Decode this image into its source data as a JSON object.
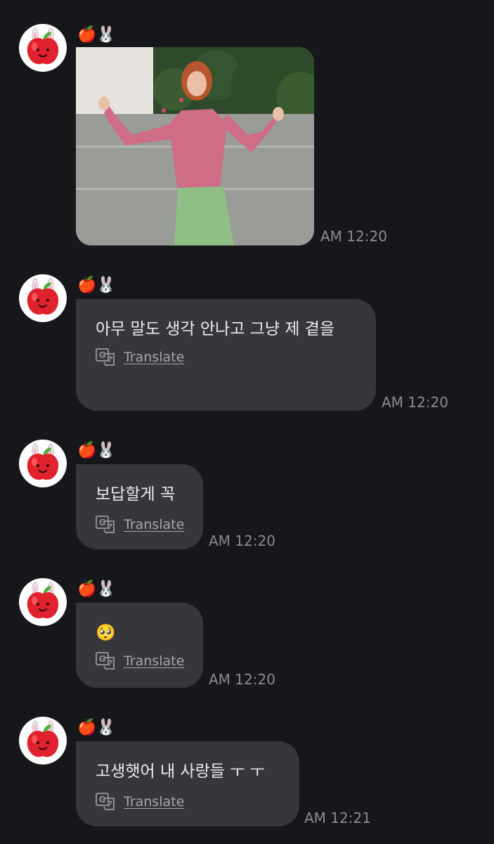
{
  "chat": {
    "sender_name": "🍎🐰",
    "translate_label": "Translate",
    "messages": [
      {
        "kind": "image",
        "time": "AM 12:20"
      },
      {
        "kind": "text",
        "text": "아무 말도 생각 안나고 그냥 제 곁을",
        "time": "AM 12:20"
      },
      {
        "kind": "text",
        "text": "보답할게 꼭",
        "time": "AM 12:20"
      },
      {
        "kind": "text",
        "text": "🥺",
        "time": "AM 12:20"
      },
      {
        "kind": "text",
        "text": "고생햇어 내 사랑들 ㅜ ㅜ",
        "time": "AM 12:21"
      }
    ]
  },
  "colors": {
    "background": "#16171b",
    "bubble": "#36363d",
    "text": "#ececef",
    "timestamp": "#8b8b92",
    "translate_link": "#a6a6ac"
  },
  "icons": {
    "avatar": "apple-bunny-icon",
    "translate": "google-translate-icon"
  }
}
